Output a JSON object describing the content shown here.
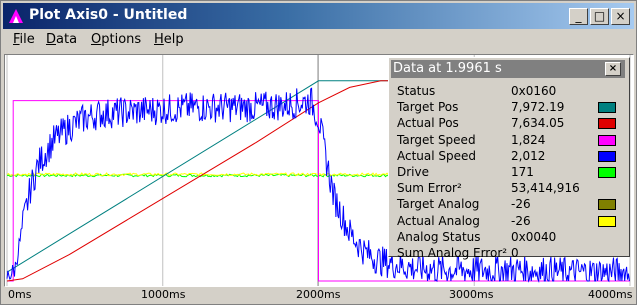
{
  "window": {
    "title": "Plot Axis0 - Untitled",
    "buttons": {
      "minimize": "_",
      "maximize": "□",
      "close": "×"
    }
  },
  "menu": [
    {
      "label": "File",
      "accel": "F",
      "rest": "ile"
    },
    {
      "label": "Data",
      "accel": "D",
      "rest": "ata"
    },
    {
      "label": "Options",
      "accel": "O",
      "rest": "ptions"
    },
    {
      "label": "Help",
      "accel": "H",
      "rest": "elp"
    }
  ],
  "chart_data": {
    "type": "line",
    "x_ticks": [
      "0ms",
      "1000ms",
      "2000ms",
      "3000ms",
      "4000ms"
    ],
    "xlim": [
      0,
      4000
    ],
    "cursor_ms": 1996.1,
    "series": [
      {
        "name": "Target Pos",
        "color": "#008080",
        "x": [
          0,
          2000,
          4000
        ],
        "y": [
          0.04,
          0.91,
          0.91
        ]
      },
      {
        "name": "Actual Pos",
        "color": "#e00000",
        "x": [
          0,
          100,
          400,
          800,
          1200,
          1600,
          2000,
          2200,
          2400,
          2700,
          3000,
          4000
        ],
        "y": [
          0.0,
          0.01,
          0.12,
          0.29,
          0.46,
          0.63,
          0.81,
          0.88,
          0.91,
          0.91,
          0.91,
          0.91
        ]
      },
      {
        "name": "Target Speed",
        "color": "#ff00ff",
        "x": [
          0,
          40,
          40,
          2000,
          2000,
          4000
        ],
        "y": [
          0.0,
          0.0,
          0.82,
          0.82,
          0.0,
          0.0
        ]
      },
      {
        "name": "Actual Speed",
        "color": "#0000ff",
        "x": [
          0,
          50,
          100,
          150,
          200,
          300,
          400,
          500,
          600,
          800,
          1000,
          1200,
          1400,
          1600,
          1800,
          1950,
          2000,
          2050,
          2100,
          2200,
          2300,
          2400,
          2600,
          2800,
          3000,
          3300,
          3600,
          4000
        ],
        "y": [
          0.02,
          0.05,
          0.25,
          0.42,
          0.53,
          0.64,
          0.7,
          0.74,
          0.76,
          0.77,
          0.78,
          0.79,
          0.79,
          0.79,
          0.8,
          0.82,
          0.74,
          0.55,
          0.38,
          0.22,
          0.13,
          0.09,
          0.06,
          0.05,
          0.05,
          0.05,
          0.04,
          0.04
        ]
      },
      {
        "name": "Drive",
        "color": "#00ff00",
        "x": [
          0,
          4000
        ],
        "y": [
          0.48,
          0.48
        ]
      },
      {
        "name": "Actual Analog",
        "color": "#ffff00",
        "x": [
          0,
          4000
        ],
        "y": [
          0.485,
          0.485
        ]
      }
    ]
  },
  "data_panel": {
    "title": "Data at 1.9961 s",
    "close_label": "×",
    "rows": [
      {
        "label": "Status",
        "value": "0x0160",
        "color": ""
      },
      {
        "label": "Target Pos",
        "value": "7,972.19",
        "color": "#008080"
      },
      {
        "label": "Actual Pos",
        "value": "7,634.05",
        "color": "#e00000"
      },
      {
        "label": "Target Speed",
        "value": "1,824",
        "color": "#ff00ff"
      },
      {
        "label": "Actual Speed",
        "value": "2,012",
        "color": "#0000ff"
      },
      {
        "label": "Drive",
        "value": "171",
        "color": "#00ff00"
      },
      {
        "label": "Sum Error²",
        "value": "53,414,916",
        "color": ""
      },
      {
        "label": "Target Analog",
        "value": "-26",
        "color": "#808000"
      },
      {
        "label": "Actual Analog",
        "value": "-26",
        "color": "#ffff00"
      },
      {
        "label": "Analog Status",
        "value": "0x0040",
        "color": ""
      },
      {
        "label": "Sum Analog Error²",
        "value": "0",
        "color": ""
      }
    ]
  }
}
